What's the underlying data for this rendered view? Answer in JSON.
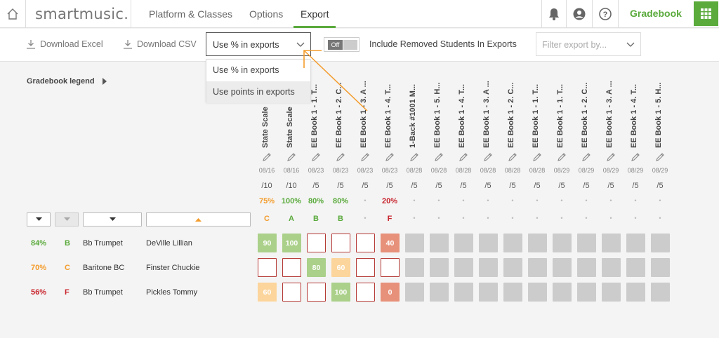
{
  "nav": {
    "logo": "smartmusic.",
    "tabs": [
      {
        "label": "Platform & Classes"
      },
      {
        "label": "Options"
      },
      {
        "label": "Export"
      }
    ],
    "gradebook": "Gradebook"
  },
  "toolbar": {
    "download_excel": "Download Excel",
    "download_csv": "Download CSV",
    "export_mode": "Use % in exports",
    "toggle_state": "Off",
    "include_removed": "Include Removed Students In Exports",
    "filter_placeholder": "Filter export by..."
  },
  "menu": {
    "options": [
      "Use % in exports",
      "Use points in exports"
    ]
  },
  "legend": {
    "label": "Gradebook legend"
  },
  "columns": [
    {
      "title": "State Scale",
      "date": "08/16",
      "max": "/10",
      "pct": "75%",
      "letter": "C"
    },
    {
      "title": "State Scale",
      "date": "08/16",
      "max": "/10",
      "pct": "100%",
      "letter": "A"
    },
    {
      "title": "EE Book 1 - 1. T...",
      "date": "08/23",
      "max": "/5",
      "pct": "80%",
      "letter": "B"
    },
    {
      "title": "EE Book 1 - 2. C...",
      "date": "08/23",
      "max": "/5",
      "pct": "80%",
      "letter": "B"
    },
    {
      "title": "EE Book 1 - 3. A ...",
      "date": "08/23",
      "max": "/5",
      "pct": "•",
      "letter": "•"
    },
    {
      "title": "EE Book 1 - 4. T...",
      "date": "08/23",
      "max": "/5",
      "pct": "20%",
      "letter": "F"
    },
    {
      "title": "1-Back #1001 M...",
      "date": "08/28",
      "max": "/5",
      "pct": "•",
      "letter": "•"
    },
    {
      "title": "EE Book 1 - 5. H...",
      "date": "08/28",
      "max": "/5",
      "pct": "•",
      "letter": "•"
    },
    {
      "title": "EE Book 1 - 4. T...",
      "date": "08/28",
      "max": "/5",
      "pct": "•",
      "letter": "•"
    },
    {
      "title": "EE Book 1 - 3. A ...",
      "date": "08/28",
      "max": "/5",
      "pct": "•",
      "letter": "•"
    },
    {
      "title": "EE Book 1 - 2. C...",
      "date": "08/28",
      "max": "/5",
      "pct": "•",
      "letter": "•"
    },
    {
      "title": "EE Book 1 - 1. T...",
      "date": "08/28",
      "max": "/5",
      "pct": "•",
      "letter": "•"
    },
    {
      "title": "EE Book 1 - 1. T...",
      "date": "08/29",
      "max": "/5",
      "pct": "•",
      "letter": "•"
    },
    {
      "title": "EE Book 1 - 2. C...",
      "date": "08/29",
      "max": "/5",
      "pct": "•",
      "letter": "•"
    },
    {
      "title": "EE Book 1 - 3. A ...",
      "date": "08/29",
      "max": "/5",
      "pct": "•",
      "letter": "•"
    },
    {
      "title": "EE Book 1 - 4. T...",
      "date": "08/29",
      "max": "/5",
      "pct": "•",
      "letter": "•"
    },
    {
      "title": "EE Book 1 - 5. H...",
      "date": "08/29",
      "max": "/5",
      "pct": "•",
      "letter": "•"
    }
  ],
  "students": [
    {
      "pct": "84%",
      "letter": "B",
      "instrument": "Bb Trumpet",
      "name": "DeVille Lillian",
      "grades": [
        {
          "v": "90",
          "s": "green"
        },
        {
          "v": "100",
          "s": "green"
        },
        {
          "v": "",
          "s": "empty"
        },
        {
          "v": "",
          "s": "empty"
        },
        {
          "v": "",
          "s": "empty"
        },
        {
          "v": "40",
          "s": "red"
        },
        {
          "v": "",
          "s": "grey"
        },
        {
          "v": "",
          "s": "grey"
        },
        {
          "v": "",
          "s": "grey"
        },
        {
          "v": "",
          "s": "grey"
        },
        {
          "v": "",
          "s": "grey"
        },
        {
          "v": "",
          "s": "grey"
        },
        {
          "v": "",
          "s": "grey"
        },
        {
          "v": "",
          "s": "grey"
        },
        {
          "v": "",
          "s": "grey"
        },
        {
          "v": "",
          "s": "grey"
        },
        {
          "v": "",
          "s": "grey"
        }
      ]
    },
    {
      "pct": "70%",
      "letter": "C",
      "instrument": "Baritone BC",
      "name": "Finster Chuckie",
      "grades": [
        {
          "v": "",
          "s": "empty"
        },
        {
          "v": "",
          "s": "empty"
        },
        {
          "v": "80",
          "s": "green"
        },
        {
          "v": "60",
          "s": "orange"
        },
        {
          "v": "",
          "s": "empty"
        },
        {
          "v": "",
          "s": "empty"
        },
        {
          "v": "",
          "s": "grey"
        },
        {
          "v": "",
          "s": "grey"
        },
        {
          "v": "",
          "s": "grey"
        },
        {
          "v": "",
          "s": "grey"
        },
        {
          "v": "",
          "s": "grey"
        },
        {
          "v": "",
          "s": "grey"
        },
        {
          "v": "",
          "s": "grey"
        },
        {
          "v": "",
          "s": "grey"
        },
        {
          "v": "",
          "s": "grey"
        },
        {
          "v": "",
          "s": "grey"
        },
        {
          "v": "",
          "s": "grey"
        }
      ]
    },
    {
      "pct": "56%",
      "letter": "F",
      "instrument": "Bb Trumpet",
      "name": "Pickles Tommy",
      "grades": [
        {
          "v": "60",
          "s": "orange"
        },
        {
          "v": "",
          "s": "empty"
        },
        {
          "v": "",
          "s": "empty"
        },
        {
          "v": "100",
          "s": "green"
        },
        {
          "v": "",
          "s": "empty"
        },
        {
          "v": "0",
          "s": "red"
        },
        {
          "v": "",
          "s": "grey"
        },
        {
          "v": "",
          "s": "grey"
        },
        {
          "v": "",
          "s": "grey"
        },
        {
          "v": "",
          "s": "grey"
        },
        {
          "v": "",
          "s": "grey"
        },
        {
          "v": "",
          "s": "grey"
        },
        {
          "v": "",
          "s": "grey"
        },
        {
          "v": "",
          "s": "grey"
        },
        {
          "v": "",
          "s": "grey"
        },
        {
          "v": "",
          "s": "grey"
        },
        {
          "v": "",
          "s": "grey"
        }
      ]
    }
  ],
  "colors": {
    "brand_green": "#5aaa3c",
    "grade_orange": "#f39c2c",
    "grade_red": "#c8232c",
    "annotation_arrow": "#f39c2c"
  }
}
